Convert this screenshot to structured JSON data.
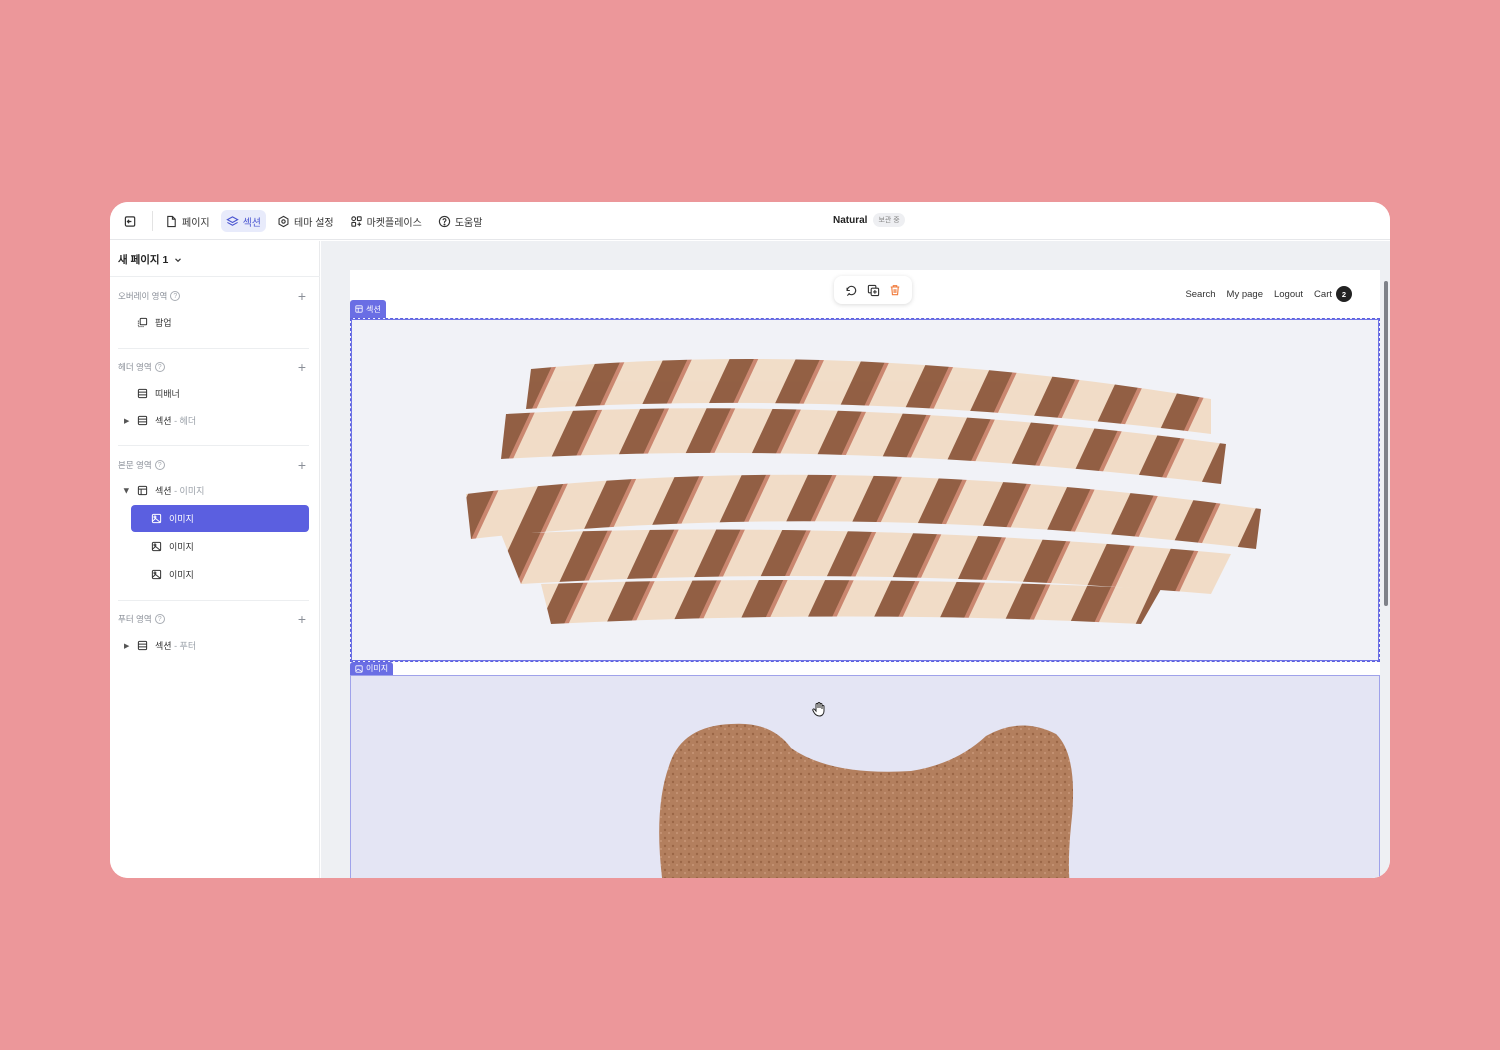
{
  "topbar": {
    "menu": [
      {
        "label": "페이지",
        "icon": "page-icon"
      },
      {
        "label": "섹션",
        "icon": "layers-icon",
        "active": true
      },
      {
        "label": "테마 설정",
        "icon": "gear-icon"
      },
      {
        "label": "마켓플레이스",
        "icon": "apps-icon"
      },
      {
        "label": "도움말",
        "icon": "help-icon"
      }
    ],
    "doc_name": "Natural",
    "doc_status": "보관 중"
  },
  "sidebar": {
    "page_name": "새 페이지 1",
    "groups": [
      {
        "title": "오버레이 영역",
        "items": [
          {
            "label": "팝업"
          }
        ]
      },
      {
        "title": "헤더 영역",
        "items": [
          {
            "label": "띠배너"
          },
          {
            "label": "섹션",
            "sub": " - 헤더"
          }
        ]
      },
      {
        "title": "본문 영역",
        "items": [
          {
            "label": "섹션",
            "sub": " - 이미지"
          },
          {
            "label": "이미지",
            "selected": true
          },
          {
            "label": "이미지"
          },
          {
            "label": "이미지"
          }
        ]
      },
      {
        "title": "푸터 영역",
        "items": [
          {
            "label": "섹션",
            "sub": " - 푸터"
          }
        ]
      }
    ]
  },
  "site": {
    "nav": {
      "search": "Search",
      "mypage": "My page",
      "logout": "Logout",
      "cart": "Cart",
      "cart_count": "2"
    },
    "section_tag": "섹션",
    "image_tag": "이미지"
  },
  "colors": {
    "accent": "#5b5fe0",
    "background": "#ec979a"
  }
}
